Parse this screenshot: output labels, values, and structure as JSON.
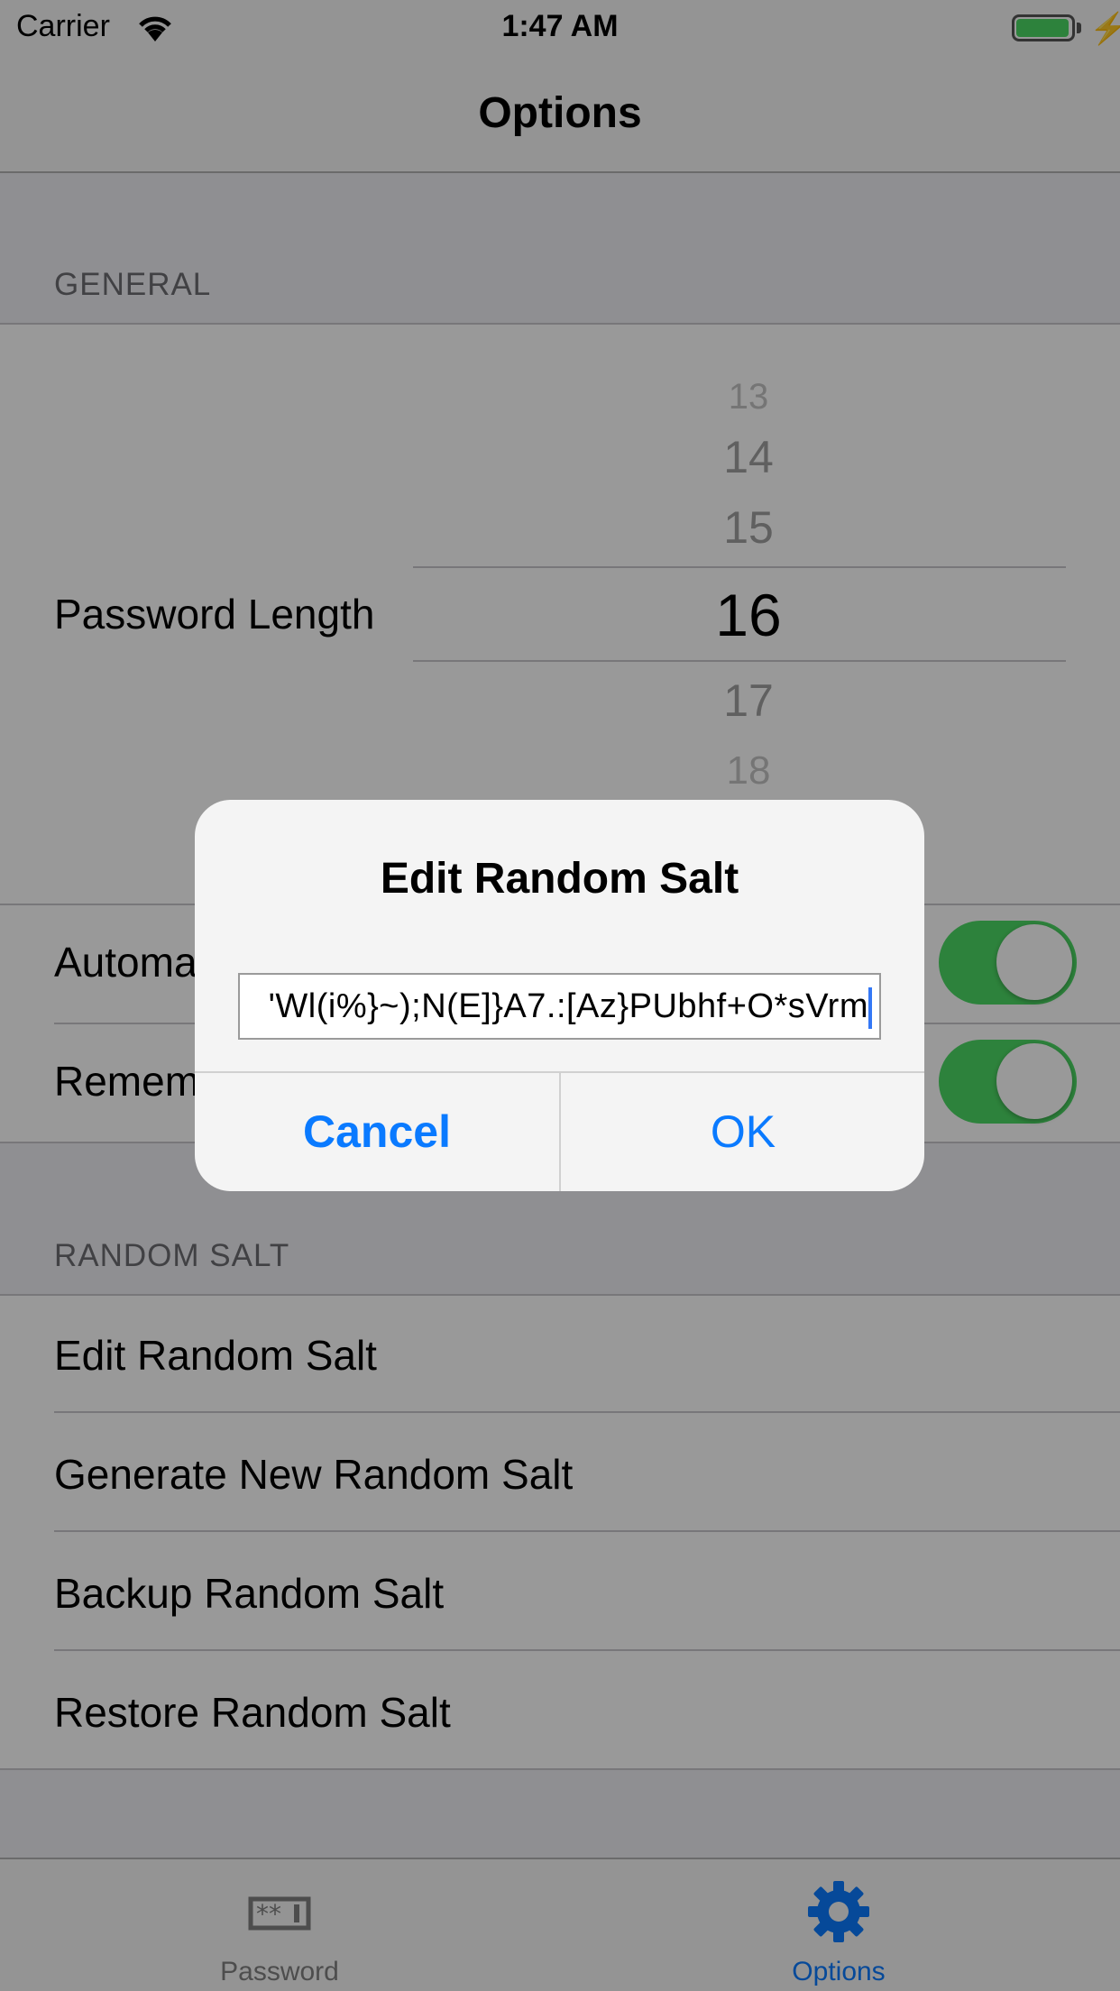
{
  "status_bar": {
    "carrier": "Carrier",
    "time": "1:47 AM"
  },
  "nav": {
    "title": "Options"
  },
  "general": {
    "header": "GENERAL",
    "password_length_label": "Password Length",
    "picker_values": [
      "13",
      "14",
      "15",
      "16",
      "17",
      "18"
    ],
    "selected_length": "16",
    "toggle_rows": [
      {
        "label": "Automa",
        "on": true
      },
      {
        "label": "Remem",
        "on": true
      }
    ]
  },
  "random_salt": {
    "header": "RANDOM SALT",
    "items": [
      "Edit Random Salt",
      "Generate New Random Salt",
      "Backup Random Salt",
      "Restore Random Salt"
    ]
  },
  "tabs": [
    {
      "label": "Password",
      "icon": "password-icon",
      "selected": false
    },
    {
      "label": "Options",
      "icon": "gear-icon",
      "selected": true
    }
  ],
  "dialog": {
    "title": "Edit Random Salt",
    "field_value": "'Wl(i%}~);N(E]}A7.:[Az}PUbhf+O*sVrm",
    "cancel_label": "Cancel",
    "ok_label": "OK"
  },
  "colors": {
    "accent": "#0a7aff",
    "toggle_on": "#4cd964"
  }
}
